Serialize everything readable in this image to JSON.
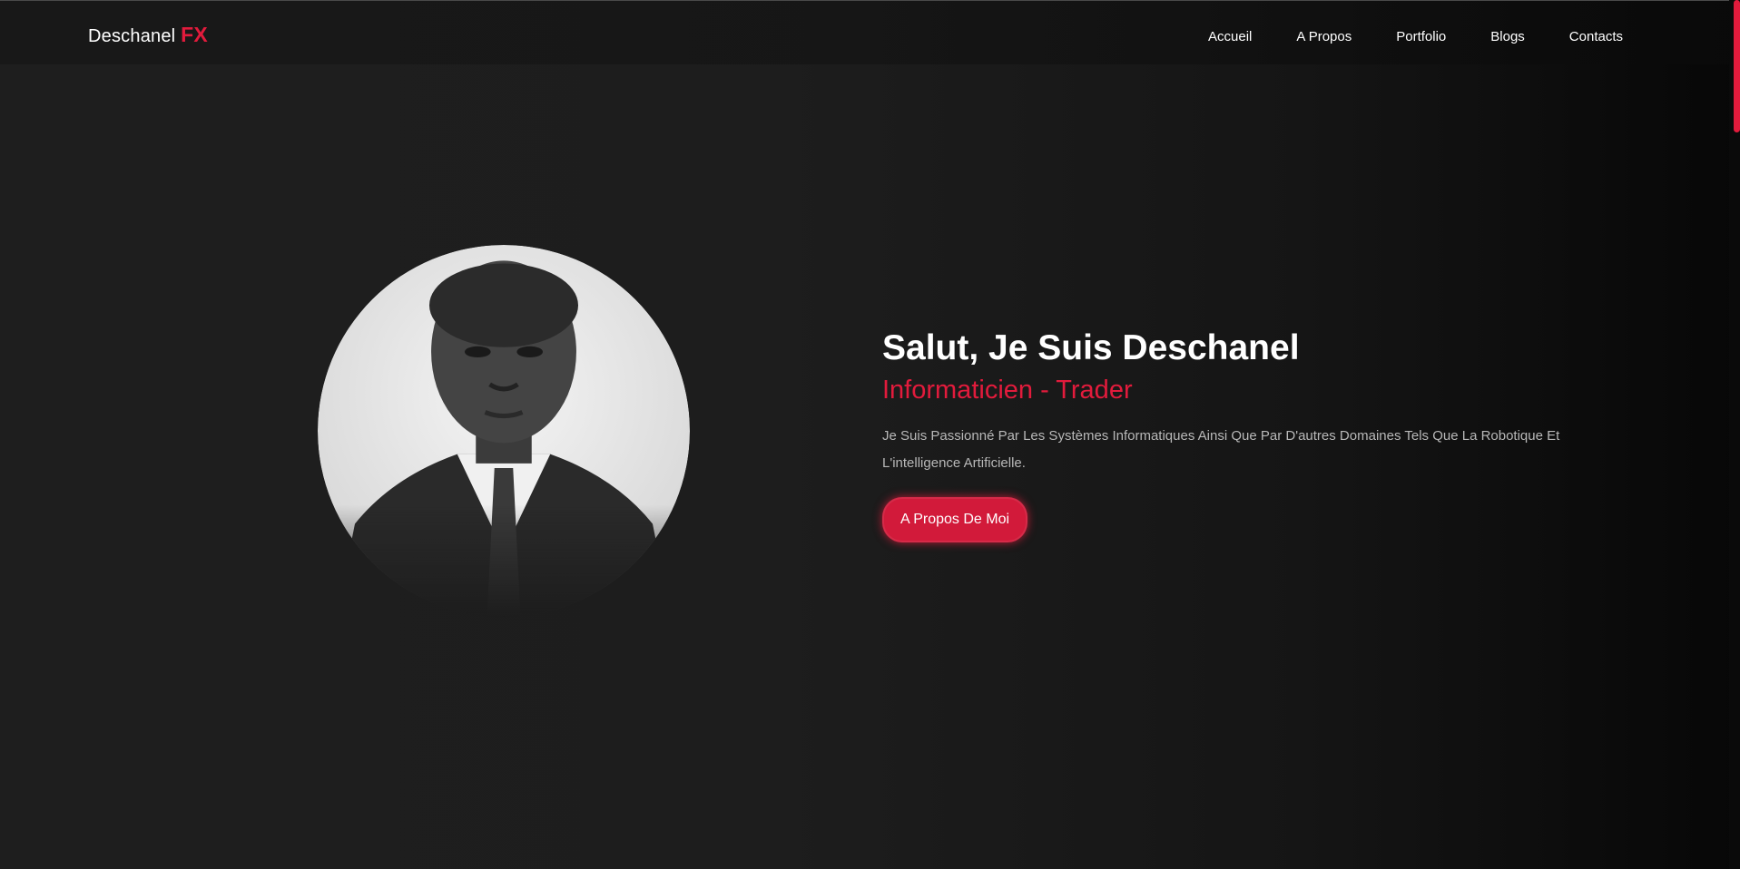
{
  "logo": {
    "name": "Deschanel",
    "accent": "FX"
  },
  "nav": {
    "items": [
      "Accueil",
      "A Propos",
      "Portfolio",
      "Blogs",
      "Contacts"
    ]
  },
  "hero": {
    "title": "Salut, Je Suis Deschanel",
    "subtitle": "Informaticien - Trader",
    "description": "Je Suis Passionné Par Les Systèmes Informatiques Ainsi Que Par D'autres Domaines Tels Que La Robotique Et L'intelligence Artificielle.",
    "button_label": "A Propos De Moi"
  },
  "colors": {
    "accent": "#e21b3c",
    "background": "#1e1e1e",
    "text": "#ffffff"
  }
}
